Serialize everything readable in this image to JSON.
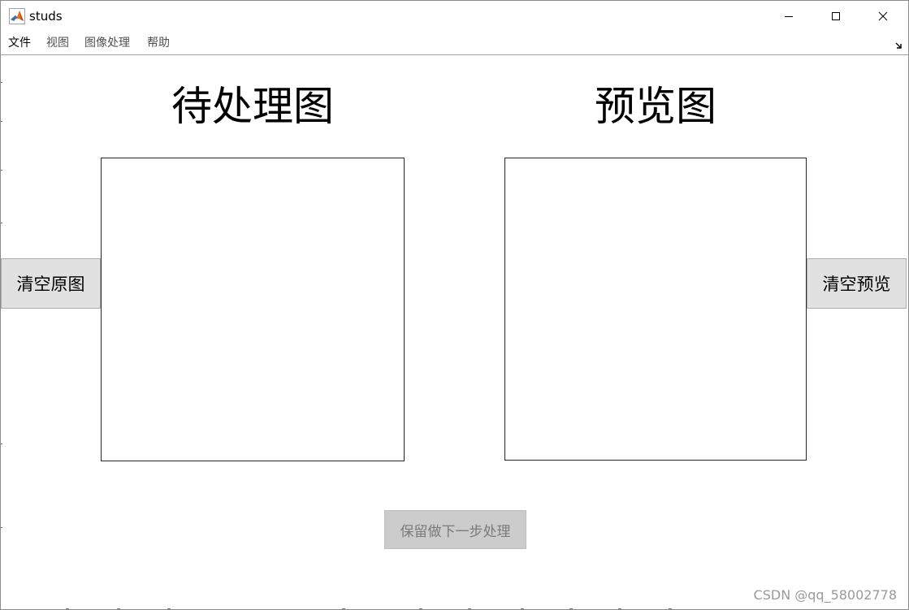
{
  "window": {
    "title": "studs",
    "icon": "matlab-icon"
  },
  "menu": {
    "items": [
      {
        "label": "文件"
      },
      {
        "label": "视图"
      },
      {
        "label": "图像处理"
      },
      {
        "label": "帮助"
      }
    ],
    "overflow_icon": "menu-arrow-icon"
  },
  "panels": {
    "left_title": "待处理图",
    "right_title": "预览图"
  },
  "buttons": {
    "clear_original": "清空原图",
    "clear_preview": "清空预览",
    "keep_next": "保留做下一步处理"
  },
  "watermark": "CSDN @qq_58002778",
  "colors": {
    "button_face": "#e1e1e1",
    "disabled_button_face": "#cccccc",
    "disabled_text": "#7a7a7a"
  }
}
